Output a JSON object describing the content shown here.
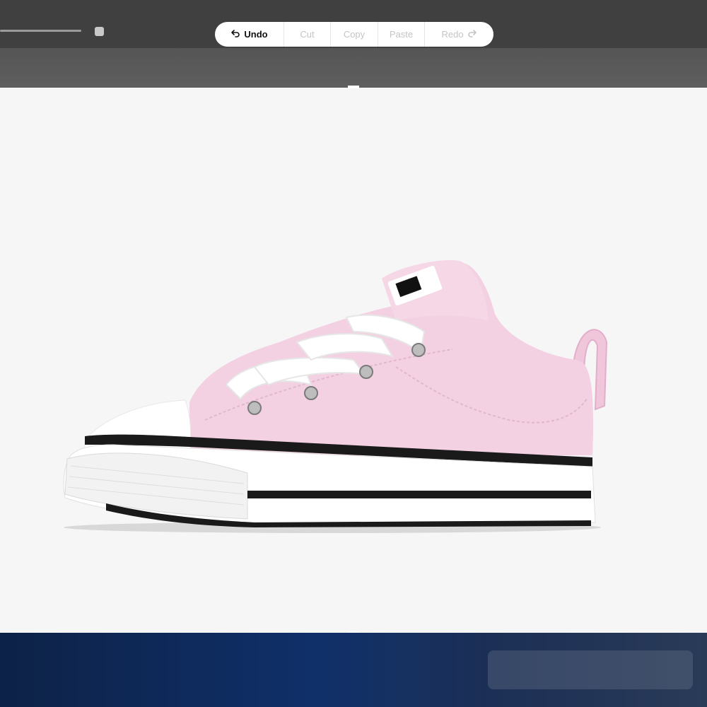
{
  "edit_menu": {
    "items": [
      {
        "label": "Undo",
        "enabled": true,
        "icon": "undo-arrow-icon"
      },
      {
        "label": "Cut",
        "enabled": false
      },
      {
        "label": "Copy",
        "enabled": false
      },
      {
        "label": "Paste",
        "enabled": false
      },
      {
        "label": "Redo",
        "enabled": false,
        "icon": "redo-arrow-icon"
      }
    ]
  },
  "colors": {
    "canvas_bg": "#f6f6f6",
    "shoe_canvas_pink": "#f2cfe0",
    "sole_white": "#ffffff",
    "stripe_black": "#1a1a1a",
    "bottom_panel_blue": "#10306a"
  }
}
